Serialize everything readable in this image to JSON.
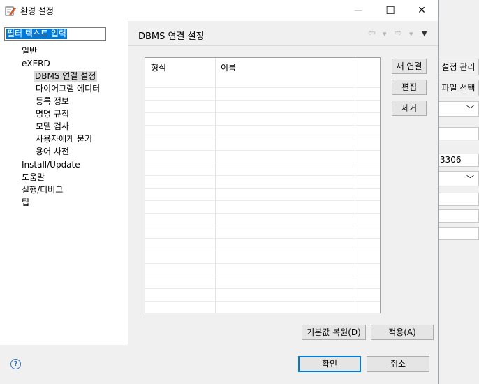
{
  "window": {
    "title": "환경 설정",
    "minimize": "—",
    "maximize": "☐",
    "close": "✕"
  },
  "filter": {
    "value": "필터 텍스트 입력"
  },
  "tree": {
    "items": [
      {
        "label": "일반"
      },
      {
        "label": "eXERD"
      },
      {
        "label": "DBMS 연결 설정",
        "selected": true
      },
      {
        "label": "다이어그램 에디터"
      },
      {
        "label": "등록 정보"
      },
      {
        "label": "명명 규칙"
      },
      {
        "label": "모델 검사"
      },
      {
        "label": "사용자에게 묻기"
      },
      {
        "label": "용어 사전"
      },
      {
        "label": "Install/Update"
      },
      {
        "label": "도움말"
      },
      {
        "label": "실행/디버그"
      },
      {
        "label": "팁"
      }
    ]
  },
  "page": {
    "title": "DBMS 연결 설정"
  },
  "nav": {
    "back": "⇦",
    "forward": "⇨",
    "dropdown": "▾",
    "menu": "▼"
  },
  "table": {
    "columns": [
      "형식",
      "이름"
    ],
    "rows": []
  },
  "buttons": {
    "new_connection": "새 연결",
    "edit": "편집",
    "remove": "제거",
    "restore_defaults": "기본값 복원(D)",
    "apply": "적용(A)",
    "ok": "확인",
    "cancel": "취소"
  },
  "help": {
    "symbol": "?"
  },
  "background": {
    "settings_manage": "설정 관리",
    "file_select": "파일 선택",
    "port_value": "3306"
  },
  "colors": {
    "selection": "#0078d7",
    "panel": "#f0f0f0",
    "primary_border": "#0078d7"
  }
}
